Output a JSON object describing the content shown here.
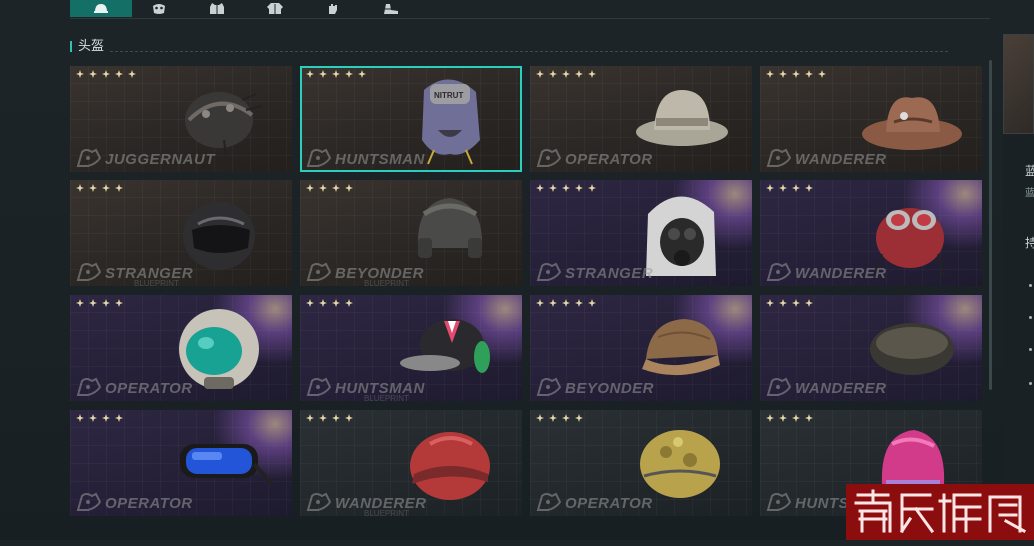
{
  "tabs": [
    {
      "icon": "helmet-icon",
      "active": true
    },
    {
      "icon": "mask-icon",
      "active": false
    },
    {
      "icon": "vest-icon",
      "active": false
    },
    {
      "icon": "jacket-icon",
      "active": false
    },
    {
      "icon": "glove-icon",
      "active": false
    },
    {
      "icon": "boots-icon",
      "active": false
    }
  ],
  "section": {
    "title": "头盔"
  },
  "cards": [
    {
      "brand": "JUGGERNAUT",
      "sub": "",
      "rarity": "gold",
      "stars": 5,
      "item": "skull-spiked-helmet",
      "selected": false
    },
    {
      "brand": "HUNTSMAN",
      "sub": "",
      "rarity": "gold",
      "stars": 5,
      "item": "hooded-cap",
      "selected": true
    },
    {
      "brand": "OPERATOR",
      "sub": "",
      "rarity": "gold",
      "stars": 5,
      "item": "boonie-hat",
      "selected": false
    },
    {
      "brand": "WANDERER",
      "sub": "",
      "rarity": "gold",
      "stars": 5,
      "item": "cowboy-hat",
      "selected": false
    },
    {
      "brand": "STRANGER",
      "sub": "BLUEPRINT",
      "rarity": "gold",
      "stars": 4,
      "item": "moto-helmet",
      "selected": false
    },
    {
      "brand": "BEYONDER",
      "sub": "BLUEPRINT",
      "rarity": "gold",
      "stars": 4,
      "item": "aviator-helmet",
      "selected": false
    },
    {
      "brand": "STRANGER",
      "sub": "",
      "rarity": "purple",
      "stars": 5,
      "item": "gasmask-hood",
      "selected": false
    },
    {
      "brand": "WANDERER",
      "sub": "",
      "rarity": "purple",
      "stars": 4,
      "item": "goggle-helmet",
      "selected": false
    },
    {
      "brand": "OPERATOR",
      "sub": "",
      "rarity": "purple",
      "stars": 4,
      "item": "space-helmet",
      "selected": false
    },
    {
      "brand": "HUNTSMAN",
      "sub": "BLUEPRINT",
      "rarity": "purple",
      "stars": 4,
      "item": "headset-cap",
      "selected": false
    },
    {
      "brand": "BEYONDER",
      "sub": "",
      "rarity": "purple",
      "stars": 5,
      "item": "leather-cap",
      "selected": false
    },
    {
      "brand": "WANDERER",
      "sub": "",
      "rarity": "purple",
      "stars": 4,
      "item": "beret",
      "selected": false
    },
    {
      "brand": "OPERATOR",
      "sub": "",
      "rarity": "purple",
      "stars": 4,
      "item": "ski-goggles",
      "selected": false
    },
    {
      "brand": "WANDERER",
      "sub": "BLUEPRINT",
      "rarity": "dark",
      "stars": 4,
      "item": "red-helmet",
      "selected": false
    },
    {
      "brand": "OPERATOR",
      "sub": "",
      "rarity": "dark",
      "stars": 4,
      "item": "camo-helmet",
      "selected": false
    },
    {
      "brand": "HUNTSMAN",
      "sub": "",
      "rarity": "dark",
      "stars": 4,
      "item": "pink-helmet",
      "selected": false
    }
  ],
  "right_panel": {
    "line1": "蓝",
    "line2": "蓝",
    "line3": "持"
  },
  "watermark": "喬氏帳號"
}
